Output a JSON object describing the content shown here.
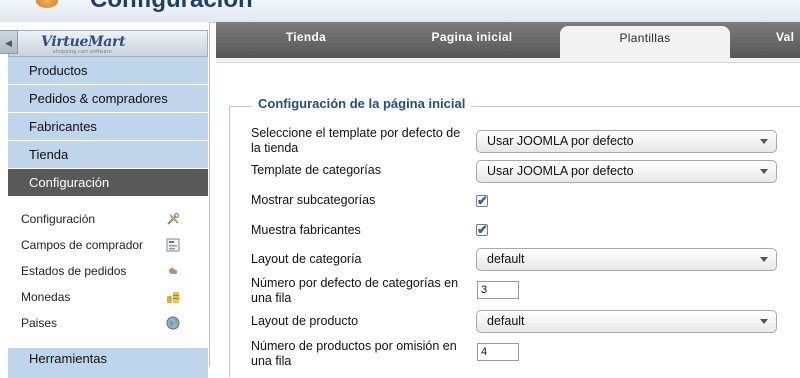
{
  "header": {
    "title": "Configuración"
  },
  "sidebar": {
    "brand": {
      "name": "VirtueMart",
      "tagline": "shopping cart software"
    },
    "menu": [
      {
        "label": "Productos"
      },
      {
        "label": "Pedidos & compradores"
      },
      {
        "label": "Fabricantes"
      },
      {
        "label": "Tienda"
      },
      {
        "label": "Configuración",
        "active": true
      }
    ],
    "submenu": [
      {
        "label": "Configuración",
        "icon": "wrench-screwdriver-icon"
      },
      {
        "label": "Campos de comprador",
        "icon": "form-fields-icon"
      },
      {
        "label": "Estados de pedidos",
        "icon": "order-status-icon"
      },
      {
        "label": "Monedas",
        "icon": "coins-icon"
      },
      {
        "label": "Paises",
        "icon": "globe-icon"
      }
    ],
    "tools_label": "Herramientas"
  },
  "tabs": [
    {
      "label": "Tienda"
    },
    {
      "label": "Pagina inicial"
    },
    {
      "label": "Plantillas",
      "active": true
    },
    {
      "label": "Val"
    }
  ],
  "section": {
    "legend": "Configuración de la página inicial",
    "fields": {
      "template_default": {
        "label": "Seleccione el template por defecto de la tienda",
        "value": "Usar JOOMLA por defecto"
      },
      "category_template": {
        "label": "Template de categorías",
        "value": "Usar JOOMLA por defecto"
      },
      "show_subcategories": {
        "label": "Mostrar subcategorías",
        "checked": true
      },
      "show_manufacturers": {
        "label": "Muestra fabricantes",
        "checked": true
      },
      "category_layout": {
        "label": "Layout de categoría",
        "value": "default"
      },
      "categories_per_row": {
        "label": "Número por defecto de categorías en una fila",
        "value": "3"
      },
      "product_layout": {
        "label": "Layout de producto",
        "value": "default"
      },
      "products_per_row": {
        "label": "Número de productos por omisión en una fila",
        "value": "4"
      }
    }
  },
  "colors": {
    "menu_bg": "#bed5ec",
    "menu_active_bg": "#595959",
    "legend_text": "#1f4f83",
    "tabbar_bg": "#575757"
  }
}
